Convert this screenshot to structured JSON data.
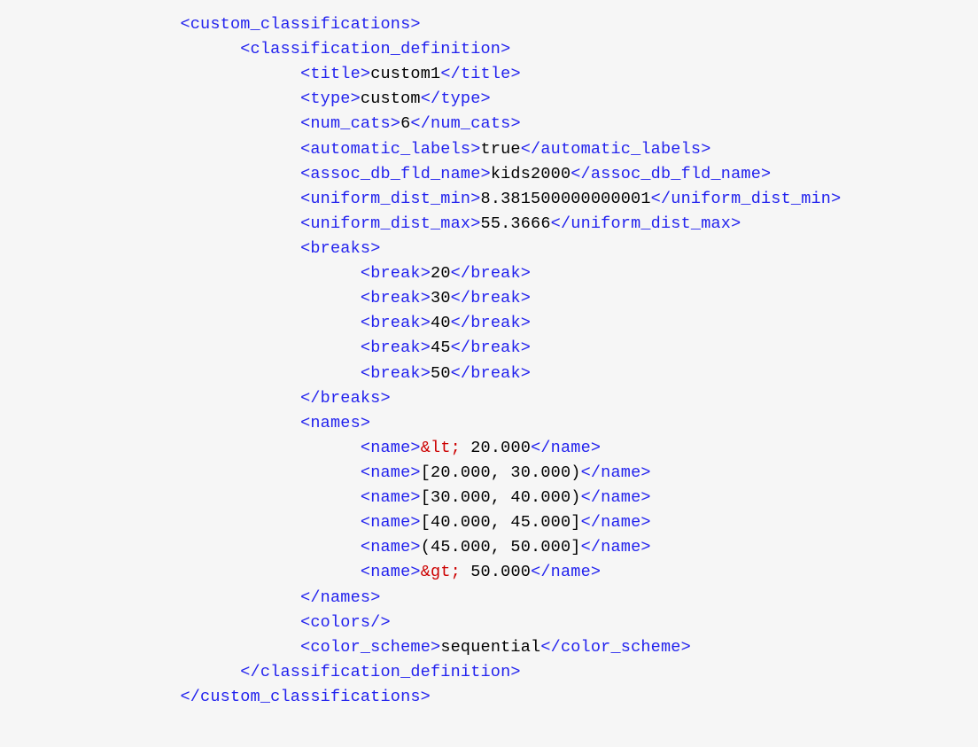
{
  "indent": {
    "base": "                  ",
    "l1": "                        ",
    "l2": "                              ",
    "l3": "                                    "
  },
  "xml": {
    "root_open": "<custom_classifications>",
    "root_close": "</custom_classifications>",
    "def_open": "<classification_definition>",
    "def_close": "</classification_definition>",
    "title_tag": "title",
    "title_val": "custom1",
    "type_tag": "type",
    "type_val": "custom",
    "num_cats_tag": "num_cats",
    "num_cats_val": "6",
    "auto_tag": "automatic_labels",
    "auto_val": "true",
    "assoc_tag": "assoc_db_fld_name",
    "assoc_val": "kids2000",
    "umin_tag": "uniform_dist_min",
    "umin_val": "8.381500000000001",
    "umax_tag": "uniform_dist_max",
    "umax_val": "55.3666",
    "breaks_tag": "breaks",
    "break_tag": "break",
    "breaks": [
      "20",
      "30",
      "40",
      "45",
      "50"
    ],
    "names_tag": "names",
    "name_tag": "name",
    "names_lt_ent": "&lt;",
    "names_lt_rest": " 20.000",
    "names_mid": [
      "[20.000, 30.000)",
      "[30.000, 40.000)",
      "[40.000, 45.000]",
      "(45.000, 50.000]"
    ],
    "names_gt_ent": "&gt;",
    "names_gt_rest": " 50.000",
    "colors_empty": "<colors/>",
    "scheme_tag": "color_scheme",
    "scheme_val": "sequential"
  }
}
